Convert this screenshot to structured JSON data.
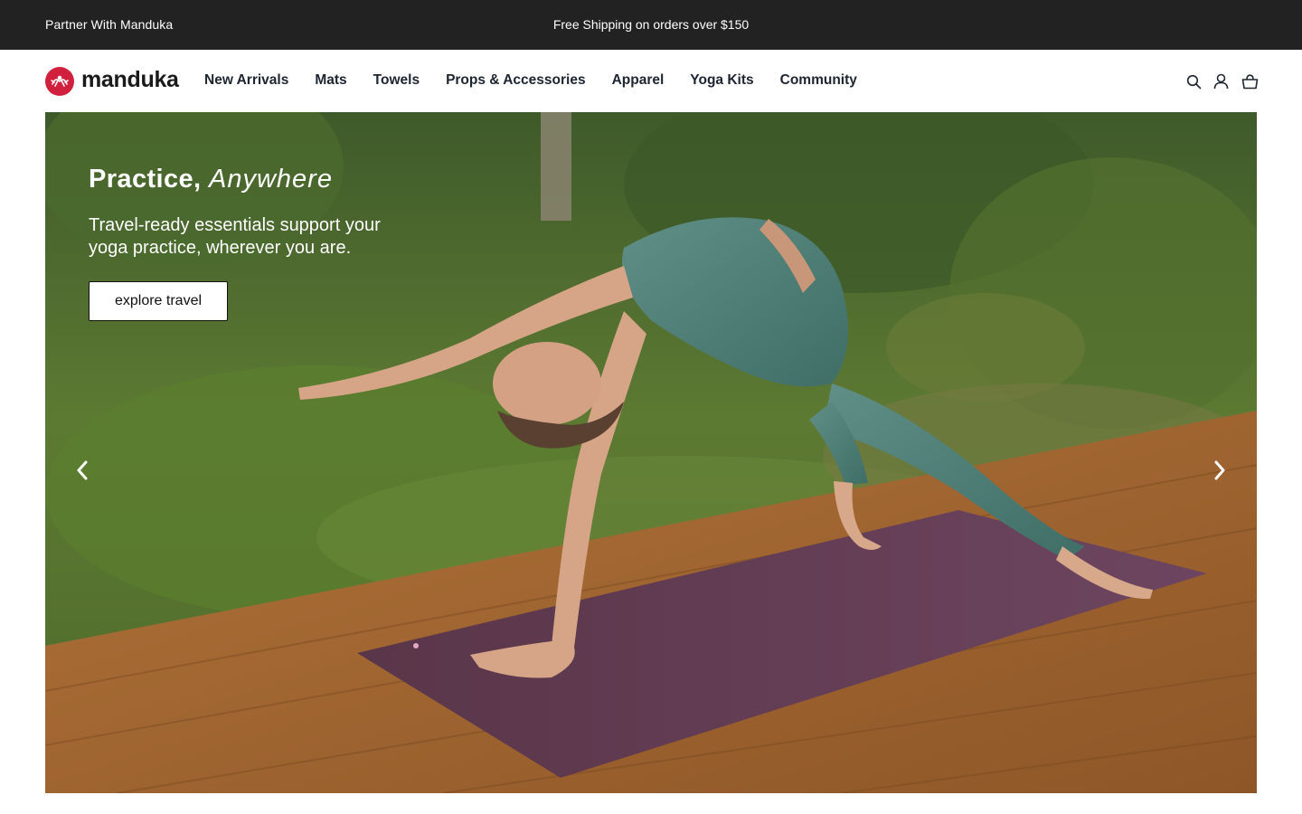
{
  "announcement": {
    "partner_link": "Partner With Manduka",
    "shipping_text": "Free Shipping on orders over $150"
  },
  "header": {
    "logo_text": "manduka",
    "nav": [
      {
        "label": "New Arrivals"
      },
      {
        "label": "Mats"
      },
      {
        "label": "Towels"
      },
      {
        "label": "Props & Accessories"
      },
      {
        "label": "Apparel"
      },
      {
        "label": "Yoga Kits"
      },
      {
        "label": "Community"
      }
    ],
    "icons": [
      "search-icon",
      "account-icon",
      "cart-icon"
    ]
  },
  "hero": {
    "title_bold": "Practice,",
    "title_italic": "Anywhere",
    "subtitle": "Travel-ready essentials support your yoga practice, wherever you are.",
    "button_label": "explore travel",
    "prev_arrow": "chevron-left-icon",
    "next_arrow": "chevron-right-icon"
  },
  "colors": {
    "announcement_bg": "#222222",
    "brand_red": "#d0203d",
    "nav_text": "#1d2530"
  }
}
